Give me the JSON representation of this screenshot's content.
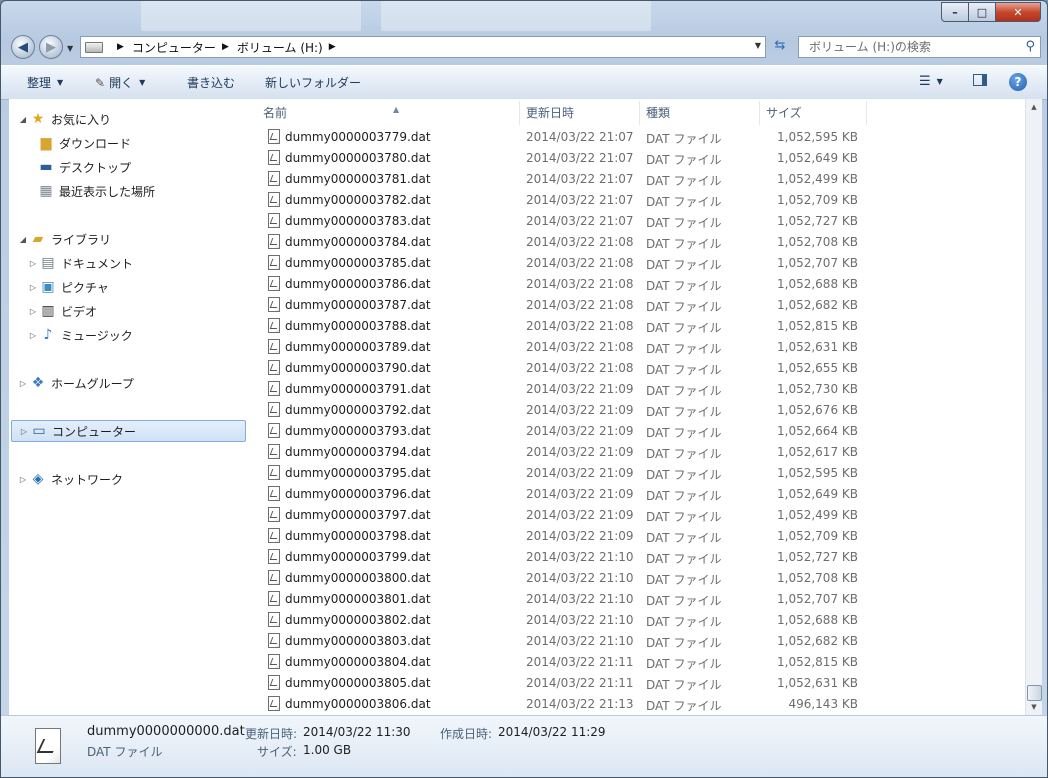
{
  "window": {
    "min_glyph": "–",
    "max_glyph": "□",
    "close_glyph": "✕"
  },
  "address": {
    "crumbs": [
      "コンピューター",
      "ボリューム (H:)"
    ],
    "search_placeholder": "ボリューム (H:)の検索"
  },
  "toolbar": {
    "organize": "整理",
    "open": "開く",
    "burn": "書き込む",
    "new_folder": "新しいフォルダー"
  },
  "nav": {
    "favorites": "お気に入り",
    "downloads": "ダウンロード",
    "desktop": "デスクトップ",
    "recent": "最近表示した場所",
    "libraries": "ライブラリ",
    "documents": "ドキュメント",
    "pictures": "ピクチャ",
    "videos": "ビデオ",
    "music": "ミュージック",
    "homegroup": "ホームグループ",
    "computer": "コンピューター",
    "network": "ネットワーク"
  },
  "columns": {
    "name": "名前",
    "date": "更新日時",
    "type": "種類",
    "size": "サイズ"
  },
  "files": [
    {
      "name": "dummy0000003779.dat",
      "date": "2014/03/22 21:07",
      "type": "DAT ファイル",
      "size": "1,052,595 KB"
    },
    {
      "name": "dummy0000003780.dat",
      "date": "2014/03/22 21:07",
      "type": "DAT ファイル",
      "size": "1,052,649 KB"
    },
    {
      "name": "dummy0000003781.dat",
      "date": "2014/03/22 21:07",
      "type": "DAT ファイル",
      "size": "1,052,499 KB"
    },
    {
      "name": "dummy0000003782.dat",
      "date": "2014/03/22 21:07",
      "type": "DAT ファイル",
      "size": "1,052,709 KB"
    },
    {
      "name": "dummy0000003783.dat",
      "date": "2014/03/22 21:07",
      "type": "DAT ファイル",
      "size": "1,052,727 KB"
    },
    {
      "name": "dummy0000003784.dat",
      "date": "2014/03/22 21:08",
      "type": "DAT ファイル",
      "size": "1,052,708 KB"
    },
    {
      "name": "dummy0000003785.dat",
      "date": "2014/03/22 21:08",
      "type": "DAT ファイル",
      "size": "1,052,707 KB"
    },
    {
      "name": "dummy0000003786.dat",
      "date": "2014/03/22 21:08",
      "type": "DAT ファイル",
      "size": "1,052,688 KB"
    },
    {
      "name": "dummy0000003787.dat",
      "date": "2014/03/22 21:08",
      "type": "DAT ファイル",
      "size": "1,052,682 KB"
    },
    {
      "name": "dummy0000003788.dat",
      "date": "2014/03/22 21:08",
      "type": "DAT ファイル",
      "size": "1,052,815 KB"
    },
    {
      "name": "dummy0000003789.dat",
      "date": "2014/03/22 21:08",
      "type": "DAT ファイル",
      "size": "1,052,631 KB"
    },
    {
      "name": "dummy0000003790.dat",
      "date": "2014/03/22 21:08",
      "type": "DAT ファイル",
      "size": "1,052,655 KB"
    },
    {
      "name": "dummy0000003791.dat",
      "date": "2014/03/22 21:09",
      "type": "DAT ファイル",
      "size": "1,052,730 KB"
    },
    {
      "name": "dummy0000003792.dat",
      "date": "2014/03/22 21:09",
      "type": "DAT ファイル",
      "size": "1,052,676 KB"
    },
    {
      "name": "dummy0000003793.dat",
      "date": "2014/03/22 21:09",
      "type": "DAT ファイル",
      "size": "1,052,664 KB"
    },
    {
      "name": "dummy0000003794.dat",
      "date": "2014/03/22 21:09",
      "type": "DAT ファイル",
      "size": "1,052,617 KB"
    },
    {
      "name": "dummy0000003795.dat",
      "date": "2014/03/22 21:09",
      "type": "DAT ファイル",
      "size": "1,052,595 KB"
    },
    {
      "name": "dummy0000003796.dat",
      "date": "2014/03/22 21:09",
      "type": "DAT ファイル",
      "size": "1,052,649 KB"
    },
    {
      "name": "dummy0000003797.dat",
      "date": "2014/03/22 21:09",
      "type": "DAT ファイル",
      "size": "1,052,499 KB"
    },
    {
      "name": "dummy0000003798.dat",
      "date": "2014/03/22 21:09",
      "type": "DAT ファイル",
      "size": "1,052,709 KB"
    },
    {
      "name": "dummy0000003799.dat",
      "date": "2014/03/22 21:10",
      "type": "DAT ファイル",
      "size": "1,052,727 KB"
    },
    {
      "name": "dummy0000003800.dat",
      "date": "2014/03/22 21:10",
      "type": "DAT ファイル",
      "size": "1,052,708 KB"
    },
    {
      "name": "dummy0000003801.dat",
      "date": "2014/03/22 21:10",
      "type": "DAT ファイル",
      "size": "1,052,707 KB"
    },
    {
      "name": "dummy0000003802.dat",
      "date": "2014/03/22 21:10",
      "type": "DAT ファイル",
      "size": "1,052,688 KB"
    },
    {
      "name": "dummy0000003803.dat",
      "date": "2014/03/22 21:10",
      "type": "DAT ファイル",
      "size": "1,052,682 KB"
    },
    {
      "name": "dummy0000003804.dat",
      "date": "2014/03/22 21:11",
      "type": "DAT ファイル",
      "size": "1,052,815 KB"
    },
    {
      "name": "dummy0000003805.dat",
      "date": "2014/03/22 21:11",
      "type": "DAT ファイル",
      "size": "1,052,631 KB"
    },
    {
      "name": "dummy0000003806.dat",
      "date": "2014/03/22 21:13",
      "type": "DAT ファイル",
      "size": "496,143 KB"
    }
  ],
  "details": {
    "name": "dummy0000000000.dat",
    "type": "DAT ファイル",
    "modified_label": "更新日時:",
    "modified_value": "2014/03/22 11:30",
    "created_label": "作成日時:",
    "created_value": "2014/03/22 11:29",
    "size_label": "サイズ:",
    "size_value": "1.00 GB"
  },
  "colors": {
    "selection": "#cfe1f6",
    "chrome": "#b9cce2",
    "header_text": "#4c607a"
  }
}
